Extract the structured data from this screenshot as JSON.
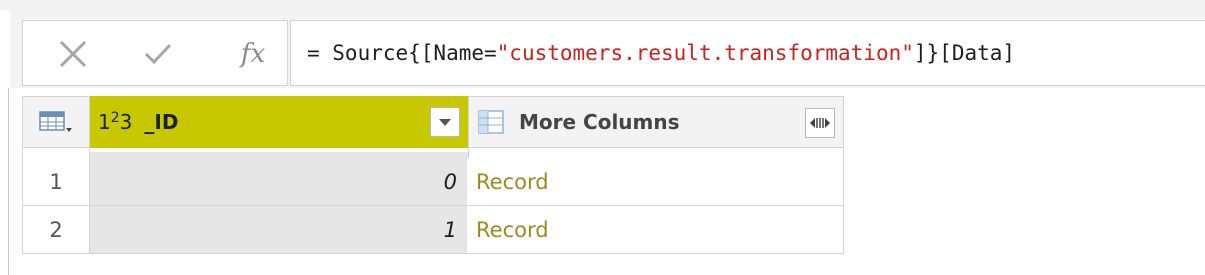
{
  "formula_bar": {
    "cancel_icon": "close-icon",
    "commit_icon": "check-icon",
    "fx_label": "fx",
    "formula_prefix": "= Source{[Name=",
    "formula_string": "\"customers.result.transformation\"",
    "formula_suffix": "]}[Data]"
  },
  "grid": {
    "columns": [
      {
        "type_label_base": "1",
        "type_label_sup": "2",
        "type_label_sub": "3",
        "name": "_ID",
        "header_color": "#c8c800"
      },
      {
        "name": "More Columns"
      }
    ],
    "rows": [
      {
        "row_number": "1",
        "id": "0",
        "more": "Record"
      },
      {
        "row_number": "2",
        "id": "1",
        "more": "Record"
      }
    ]
  },
  "colors": {
    "record_link": "#a08a1e",
    "formula_string": "#c8231f",
    "selected_header": "#c8c800"
  }
}
